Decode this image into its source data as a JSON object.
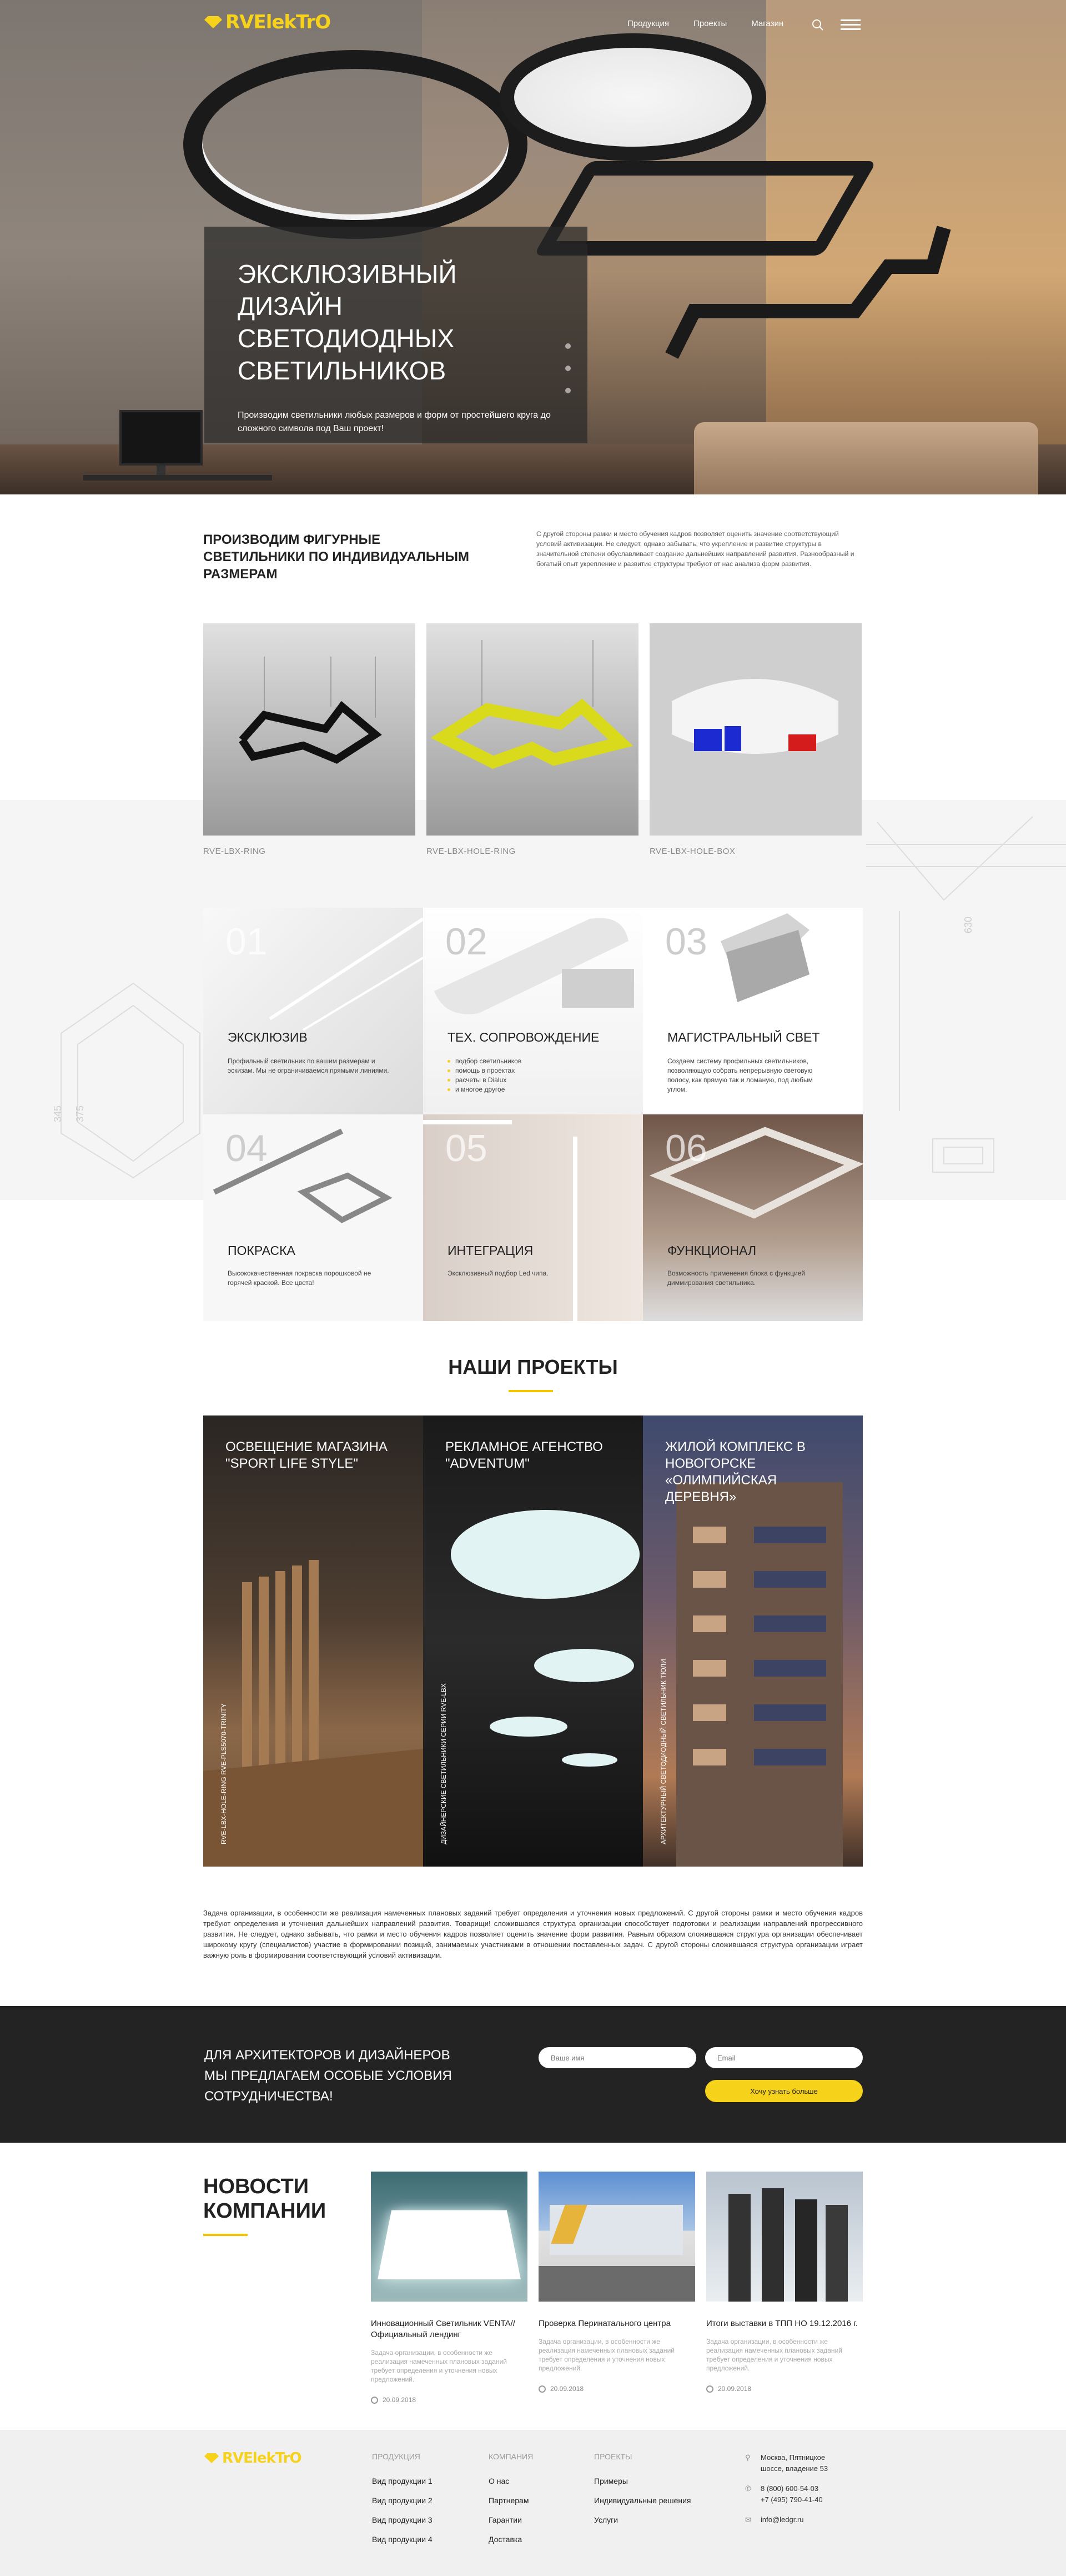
{
  "header": {
    "logo_text": "RVElekTrO",
    "nav": [
      "Продукция",
      "Проекты",
      "Магазин"
    ]
  },
  "hero": {
    "title": "Эксклюзивный дизайн светодиодных светильников",
    "subtitle": "Производим светильники любых размеров и форм от простейшего круга до сложного символа под Ваш проект!"
  },
  "intro": {
    "title": "Производим фигурные светильники по индивидуальным размерам",
    "text": "С другой стороны рамки и место обучения кадров позволяет оценить значение соответствующий условий активизации. Не следует, однако забывать, что укрепление и развитие структуры в значительной степени обуславливает создание дальнейших направлений развития. Разнообразный и богатый опыт укрепление и развитие структуры требуют от нас анализа форм развития."
  },
  "products": [
    {
      "label": "RVE-LBX-RING"
    },
    {
      "label": "RVE-LBX-HOLE-RING"
    },
    {
      "label": "RVE-LBX-HOLE-BOX"
    }
  ],
  "features": [
    {
      "num": "01",
      "title": "Эксклюзив",
      "desc": "Профильный светильник по вашим размерам и эскизам. Мы не ограничиваемся прямыми линиями."
    },
    {
      "num": "02",
      "title": "Тех. сопровождение",
      "items": [
        "подбор светильников",
        "помощь в проектах",
        "расчеты в Dialux",
        "и многое другое"
      ]
    },
    {
      "num": "03",
      "title": "Магистральный свет",
      "desc": "Создаем систему профильных светильников, позволяющую собрать непрерывную световую полосу, как прямую так и ломаную, под любым углом."
    },
    {
      "num": "04",
      "title": "Покраска",
      "desc": "Высококачественная покраска порошковой не горячей краской. Все цвета!"
    },
    {
      "num": "05",
      "title": "Интеграция",
      "desc": "Эксклюзивный подбор Led чипа."
    },
    {
      "num": "06",
      "title": "Функционал",
      "desc": "Возможность применения блока с функцией диммирования светильника."
    }
  ],
  "projects_section": {
    "heading": "Наши проекты",
    "items": [
      {
        "title": "Освещение магазина \"Sport Life Style\"",
        "vertical": "RVE-LBX-HOLE-RING RVE-PLS5070-TRINITY"
      },
      {
        "title": "Рекламное агенство \"Adventum\"",
        "vertical": "ДИЗАЙНЕРСКИЕ СВЕТИЛЬНИКИ СЕРИИ RVE-LBX"
      },
      {
        "title": "Жилой комплекс в Новогорске «Олимпийская деревня»",
        "vertical": "АРХИТЕКТУРНЫЙ СВЕТОДИОДНЫЙ СВЕТИЛЬНИК ТЮЛИ"
      }
    ],
    "text": "Задача организации, в особенности же реализация намеченных плановых заданий требует определения и уточнения новых предложений. С другой стороны рамки и место обучения кадров требуют определения и уточнения дальнейших направлений развития. Товарищи! сложившаяся структура организации способствует подготовки и реализации направлений прогрессивного развития. Не следует, однако забывать, что рамки и место обучения кадров позволяет оценить значение форм развития. Равным образом сложившаяся структура организации обеспечивает широкому кругу (специалистов) участие в формировании позиций, занимаемых участниками в отношении поставленных задач. С другой стороны сложившаяся структура организации играет важную роль в формировании соответствующий условий активизации."
  },
  "cta": {
    "text": "Для архитекторов и дизайнеров мы предлагаем особые условия сотрудничества!",
    "name_placeholder": "Ваше имя",
    "email_placeholder": "Email",
    "button": "Хочу узнать больше"
  },
  "news_section": {
    "heading": "Новости компании",
    "items": [
      {
        "title": "Инновационный Светильник VENTA// Официальный лендинг",
        "desc": "Задача организации, в особенности же реализация намеченных плановых заданий требует определения и уточнения новых предложений.",
        "date": "20.09.2018"
      },
      {
        "title": "Проверка Перинатального центра",
        "desc": "Задача организации, в особенности же реализация намеченных плановых заданий требует определения и уточнения новых предложений.",
        "date": "20.09.2018"
      },
      {
        "title": "Итоги выставки в ТПП НО 19.12.2016 г.",
        "desc": "Задача организации, в особенности же реализация намеченных плановых заданий требует определения и уточнения новых предложений.",
        "date": "20.09.2018"
      }
    ]
  },
  "footer": {
    "columns": [
      {
        "head": "Продукция",
        "items": [
          "Вид продукции 1",
          "Вид продукции 2",
          "Вид продукции 3",
          "Вид продукции 4"
        ]
      },
      {
        "head": "Компания",
        "items": [
          "О нас",
          "Партнерам",
          "Гарантии",
          "Доставка"
        ]
      },
      {
        "head": "Проекты",
        "items": [
          "Примеры",
          "Индивидуальные решения",
          "Услуги"
        ]
      }
    ],
    "address": "Москва, Пятницкое шоссе, владение 53",
    "phone1": "8 (800) 600-54-03",
    "phone2": "+7 (495) 790-41-40",
    "email": "info@ledgr.ru"
  },
  "colors": {
    "accent": "#f6d21a",
    "dark": "#232323",
    "footer_bg": "#f0f0f0"
  }
}
